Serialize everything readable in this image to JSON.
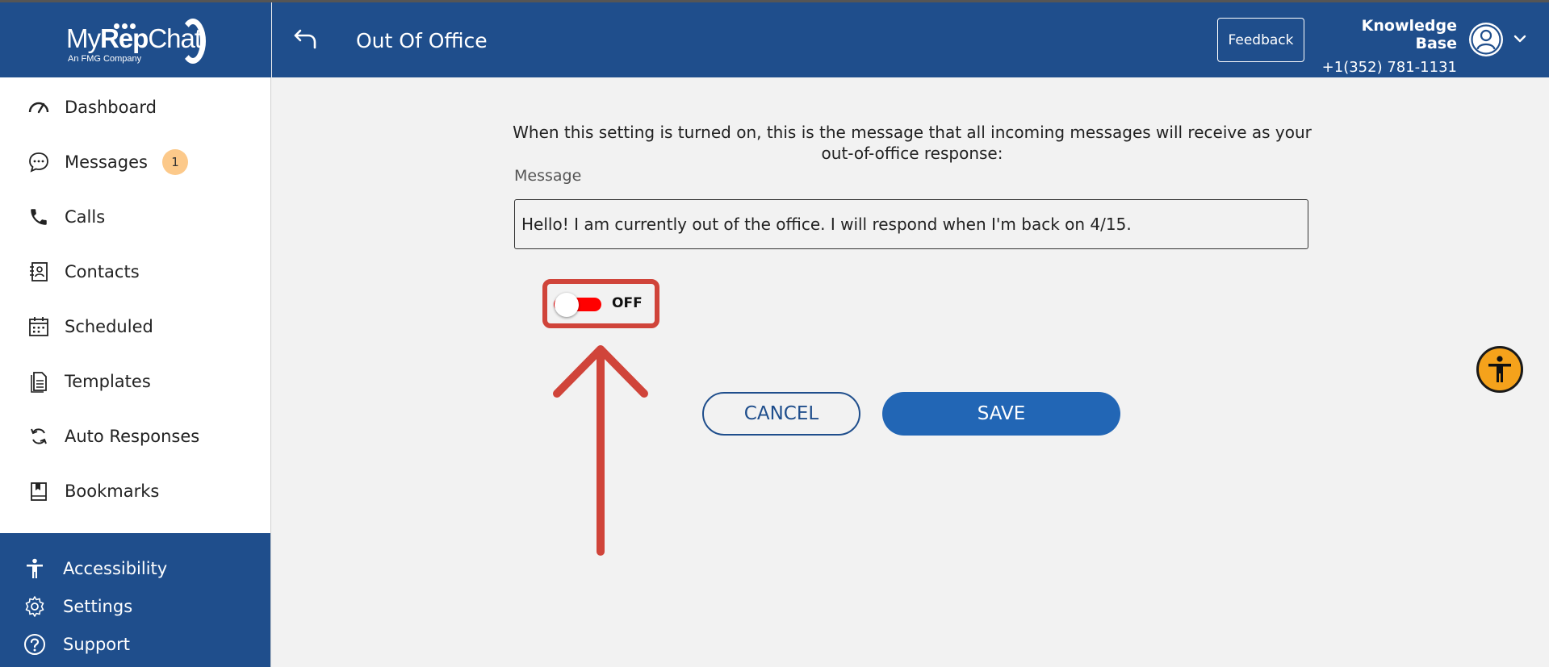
{
  "app": {
    "logo_text_light": "My",
    "logo_text_bold": "Rep",
    "logo_text_end": "Chat",
    "logo_sub": "An FMG Company"
  },
  "sidebar": {
    "items": [
      {
        "label": "Dashboard",
        "icon": "speedometer-icon"
      },
      {
        "label": "Messages",
        "icon": "chat-bubble-icon",
        "badge": "1"
      },
      {
        "label": "Calls",
        "icon": "phone-icon"
      },
      {
        "label": "Contacts",
        "icon": "contact-book-icon"
      },
      {
        "label": "Scheduled",
        "icon": "calendar-icon"
      },
      {
        "label": "Templates",
        "icon": "document-icon"
      },
      {
        "label": "Auto Responses",
        "icon": "refresh-icon"
      },
      {
        "label": "Bookmarks",
        "icon": "bookmark-icon"
      }
    ],
    "bottom_items": [
      {
        "label": "Accessibility",
        "icon": "person-icon"
      },
      {
        "label": "Settings",
        "icon": "gear-icon"
      },
      {
        "label": "Support",
        "icon": "help-icon"
      }
    ]
  },
  "header": {
    "title": "Out Of Office",
    "feedback_label": "Feedback",
    "account_name": "Knowledge Base",
    "account_phone": "+1(352) 781-1131"
  },
  "main": {
    "instructions": "When this setting is turned on, this is the message that all incoming messages will receive as your out-of-office response:",
    "message_label": "Message",
    "message_value": "Hello! I am currently out of the office. I will respond when I'm back on 4/15.",
    "toggle_state": "OFF",
    "cancel_label": "CANCEL",
    "save_label": "SAVE"
  },
  "colors": {
    "brand": "#1f4e8c",
    "save": "#2266b5",
    "toggle_off": "#ff0000",
    "badge": "#fcc98a",
    "highlight": "#d0443a",
    "a11y_fab": "#f5a21b"
  }
}
